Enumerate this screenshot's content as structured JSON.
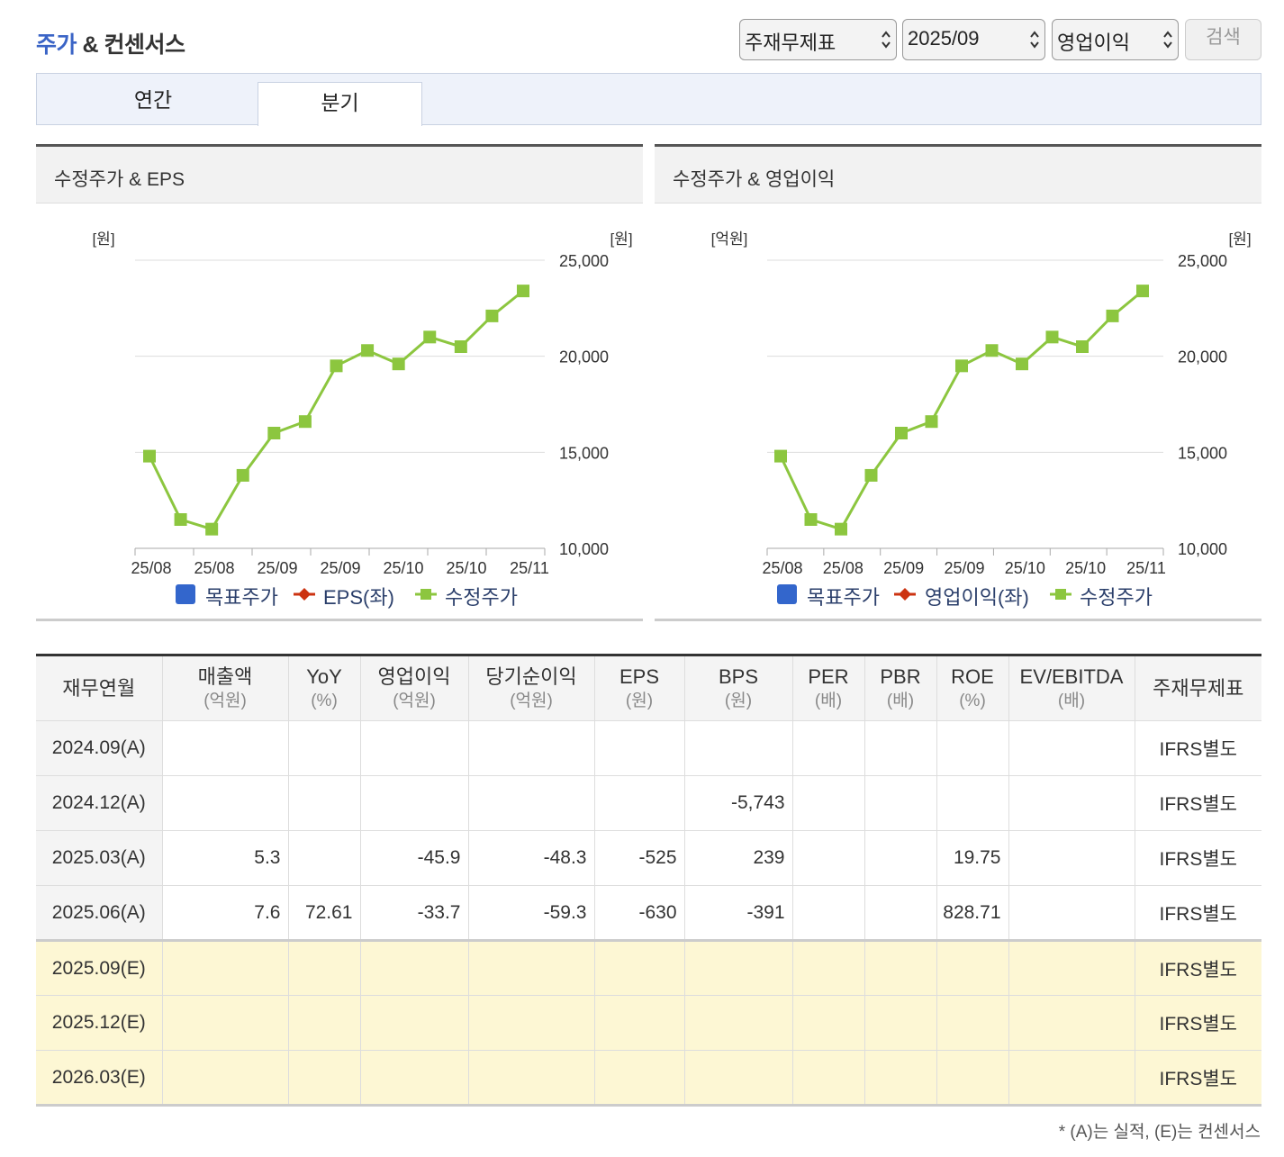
{
  "header": {
    "title_highlight": "주가",
    "title_rest": " & 컨센서스",
    "selects": {
      "statement": "주재무제표",
      "period": "2025/09",
      "metric": "영업이익"
    },
    "search_label": "검색"
  },
  "tabs": [
    {
      "label": "연간",
      "active": false
    },
    {
      "label": "분기",
      "active": true
    }
  ],
  "charts": [
    {
      "title": "수정주가 & EPS",
      "left_unit": "[원]",
      "right_unit": "[원]",
      "legend": [
        "목표주가",
        "EPS(좌)",
        "수정주가"
      ]
    },
    {
      "title": "수정주가 & 영업이익",
      "left_unit": "[억원]",
      "right_unit": "[원]",
      "legend": [
        "목표주가",
        "영업이익(좌)",
        "수정주가"
      ]
    }
  ],
  "chart_data": [
    {
      "type": "line",
      "title": "수정주가 & EPS",
      "x_ticks": [
        "25/08",
        "25/08",
        "25/09",
        "25/09",
        "25/10",
        "25/10",
        "25/11"
      ],
      "series": [
        {
          "name": "수정주가",
          "values": [
            14800,
            11500,
            11000,
            13800,
            16000,
            16600,
            19500,
            20300,
            19600,
            21000,
            20500,
            22100,
            23400
          ]
        }
      ],
      "y_right_ticks": [
        "10,000",
        "15,000",
        "20,000",
        "25,000"
      ],
      "y_right_range": [
        10000,
        25000
      ],
      "legend": [
        "목표주가",
        "EPS(좌)",
        "수정주가"
      ],
      "legend_position": "bottom",
      "grid": true
    },
    {
      "type": "line",
      "title": "수정주가 & 영업이익",
      "x_ticks": [
        "25/08",
        "25/08",
        "25/09",
        "25/09",
        "25/10",
        "25/10",
        "25/11"
      ],
      "series": [
        {
          "name": "수정주가",
          "values": [
            14800,
            11500,
            11000,
            13800,
            16000,
            16600,
            19500,
            20300,
            19600,
            21000,
            20500,
            22100,
            23400
          ]
        }
      ],
      "y_right_ticks": [
        "10,000",
        "15,000",
        "20,000",
        "25,000"
      ],
      "y_right_range": [
        10000,
        25000
      ],
      "legend": [
        "목표주가",
        "영업이익(좌)",
        "수정주가"
      ],
      "legend_position": "bottom",
      "grid": true
    }
  ],
  "colors": {
    "price_line": "#8cc63f",
    "target": "#3366cc",
    "eps": "#cc3311",
    "grid": "#dddddd"
  },
  "table": {
    "headers": [
      {
        "label": "재무연월",
        "unit": ""
      },
      {
        "label": "매출액",
        "unit": "(억원)"
      },
      {
        "label": "YoY",
        "unit": "(%)"
      },
      {
        "label": "영업이익",
        "unit": "(억원)"
      },
      {
        "label": "당기순이익",
        "unit": "(억원)"
      },
      {
        "label": "EPS",
        "unit": "(원)"
      },
      {
        "label": "BPS",
        "unit": "(원)"
      },
      {
        "label": "PER",
        "unit": "(배)"
      },
      {
        "label": "PBR",
        "unit": "(배)"
      },
      {
        "label": "ROE",
        "unit": "(%)"
      },
      {
        "label": "EV/EBITDA",
        "unit": "(배)"
      },
      {
        "label": "주재무제표",
        "unit": ""
      }
    ],
    "rows": [
      {
        "period": "2024.09(A)",
        "estimate": false,
        "cells": [
          "",
          "",
          "",
          "",
          "",
          "",
          "",
          "",
          "",
          ""
        ],
        "standard": "IFRS별도"
      },
      {
        "period": "2024.12(A)",
        "estimate": false,
        "cells": [
          "",
          "",
          "",
          "",
          "",
          "-5,743",
          "",
          "",
          "",
          ""
        ],
        "standard": "IFRS별도"
      },
      {
        "period": "2025.03(A)",
        "estimate": false,
        "cells": [
          "5.3",
          "",
          "-45.9",
          "-48.3",
          "-525",
          "239",
          "",
          "",
          "19.75",
          ""
        ],
        "standard": "IFRS별도"
      },
      {
        "period": "2025.06(A)",
        "estimate": false,
        "cells": [
          "7.6",
          "72.61",
          "-33.7",
          "-59.3",
          "-630",
          "-391",
          "",
          "",
          "828.71",
          ""
        ],
        "standard": "IFRS별도"
      },
      {
        "period": "2025.09(E)",
        "estimate": true,
        "cells": [
          "",
          "",
          "",
          "",
          "",
          "",
          "",
          "",
          "",
          ""
        ],
        "standard": "IFRS별도"
      },
      {
        "period": "2025.12(E)",
        "estimate": true,
        "cells": [
          "",
          "",
          "",
          "",
          "",
          "",
          "",
          "",
          "",
          ""
        ],
        "standard": "IFRS별도"
      },
      {
        "period": "2026.03(E)",
        "estimate": true,
        "cells": [
          "",
          "",
          "",
          "",
          "",
          "",
          "",
          "",
          "",
          ""
        ],
        "standard": "IFRS별도"
      }
    ]
  },
  "footnote": "* (A)는 실적, (E)는 컨센서스"
}
